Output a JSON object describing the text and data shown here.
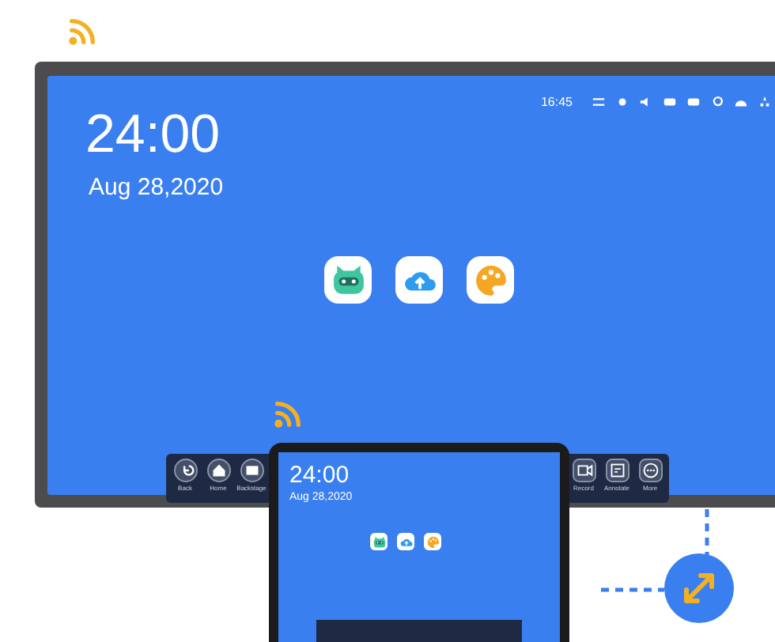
{
  "display": {
    "status_time": "16:45",
    "clock": "24:00",
    "date": "Aug 28,2020",
    "apps": [
      {
        "kind": "robot"
      },
      {
        "kind": "upload"
      },
      {
        "kind": "palette"
      }
    ],
    "dock_left": [
      {
        "kind": "back",
        "label": "Back"
      },
      {
        "kind": "home",
        "label": "Home"
      },
      {
        "kind": "window",
        "label": "Backstage"
      }
    ],
    "dock_right": [
      {
        "kind": "record",
        "label": "Record"
      },
      {
        "kind": "screen",
        "label": "Annotate"
      },
      {
        "kind": "more",
        "label": "More"
      }
    ]
  },
  "laptop": {
    "clock": "24:00",
    "date": "Aug 28,2020",
    "apps": [
      {
        "kind": "robot"
      },
      {
        "kind": "upload"
      },
      {
        "kind": "palette"
      }
    ]
  }
}
